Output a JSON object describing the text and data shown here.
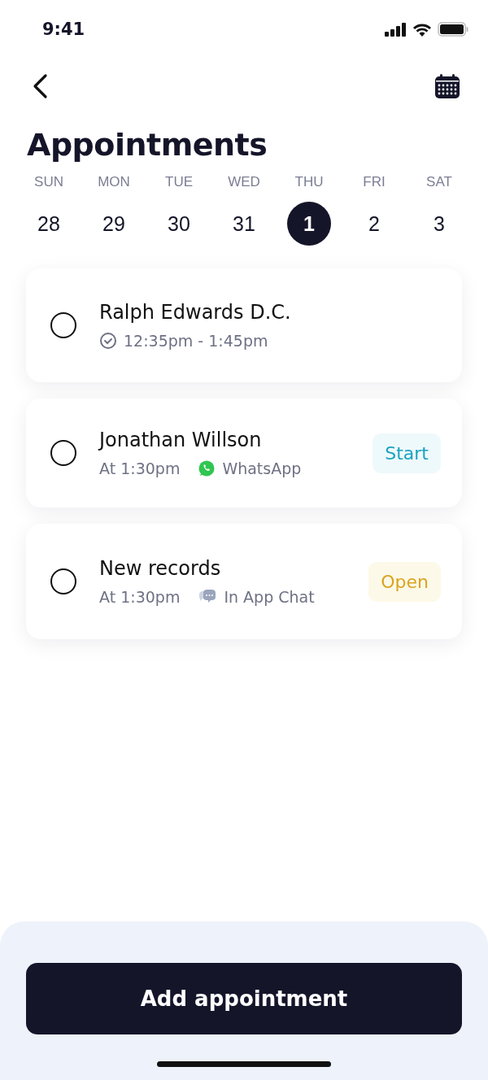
{
  "status_bar": {
    "time": "9:41"
  },
  "title": "Appointments",
  "days": [
    {
      "weekday": "SUN",
      "date": "28",
      "selected": false
    },
    {
      "weekday": "MON",
      "date": "29",
      "selected": false
    },
    {
      "weekday": "TUE",
      "date": "30",
      "selected": false
    },
    {
      "weekday": "WED",
      "date": "31",
      "selected": false
    },
    {
      "weekday": "THU",
      "date": "1",
      "selected": true
    },
    {
      "weekday": "FRI",
      "date": "2",
      "selected": false
    },
    {
      "weekday": "SAT",
      "date": "3",
      "selected": false
    }
  ],
  "appointments": [
    {
      "name": "Ralph Edwards D.C.",
      "checked": false,
      "kind": "range",
      "time": "12:35pm - 1:45pm"
    },
    {
      "name": "Jonathan Willson",
      "checked": false,
      "kind": "channel",
      "time": "At 1:30pm",
      "channel": {
        "kind": "whatsapp",
        "label": "WhatsApp"
      },
      "action": {
        "kind": "start",
        "label": "Start"
      }
    },
    {
      "name": "New records",
      "checked": false,
      "kind": "channel",
      "time": "At 1:30pm",
      "channel": {
        "kind": "chat",
        "label": "In App Chat"
      },
      "action": {
        "kind": "open",
        "label": "Open"
      }
    }
  ],
  "primary_button": "Add appointment"
}
